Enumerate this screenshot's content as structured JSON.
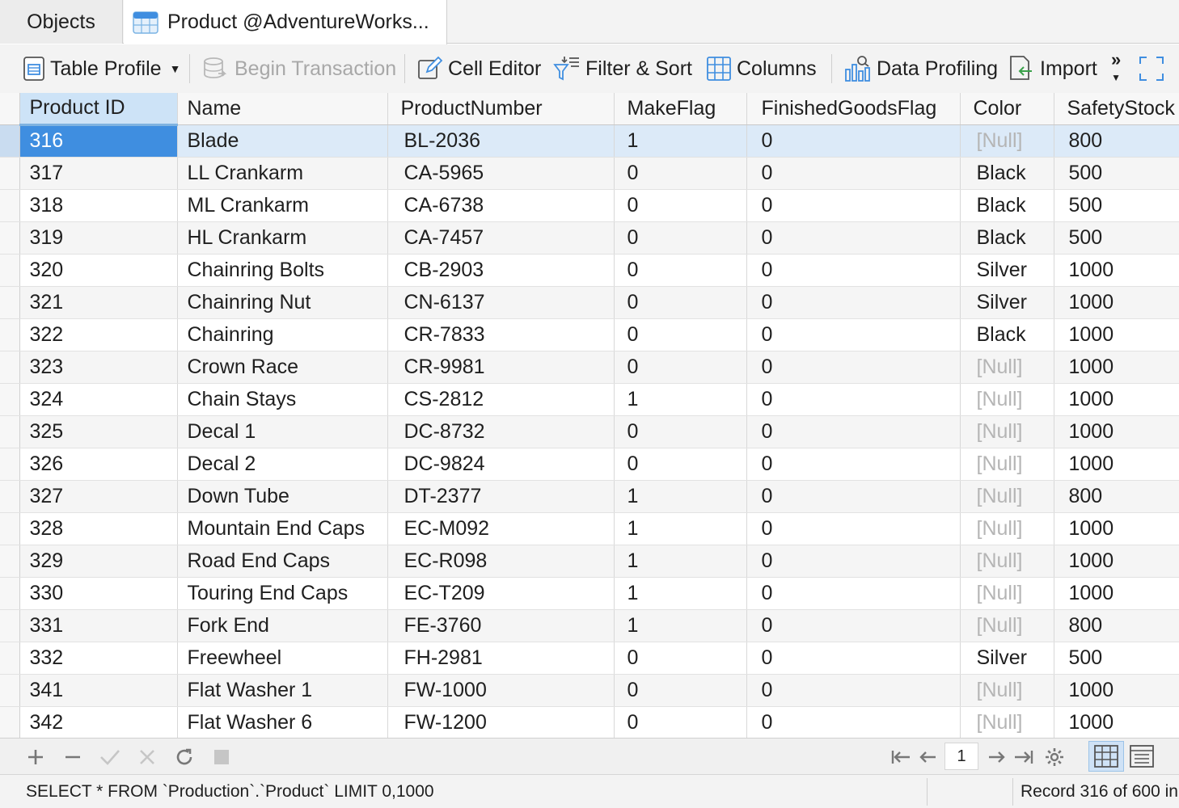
{
  "tabs": [
    {
      "label": "Objects"
    },
    {
      "label": "Product @AdventureWorks..."
    }
  ],
  "toolbar": {
    "table_profile": "Table Profile",
    "begin_transaction": "Begin Transaction",
    "cell_editor": "Cell Editor",
    "filter_sort": "Filter & Sort",
    "columns": "Columns",
    "data_profiling": "Data Profiling",
    "import": "Import",
    "more": "»"
  },
  "grid": {
    "columns": [
      "Product ID",
      "Name",
      "ProductNumber",
      "MakeFlag",
      "FinishedGoodsFlag",
      "Color",
      "SafetyStock"
    ],
    "rows": [
      [
        "316",
        "Blade",
        "BL-2036",
        "1",
        "0",
        "[Null]",
        "800"
      ],
      [
        "317",
        "LL Crankarm",
        "CA-5965",
        "0",
        "0",
        "Black",
        "500"
      ],
      [
        "318",
        "ML Crankarm",
        "CA-6738",
        "0",
        "0",
        "Black",
        "500"
      ],
      [
        "319",
        "HL Crankarm",
        "CA-7457",
        "0",
        "0",
        "Black",
        "500"
      ],
      [
        "320",
        "Chainring Bolts",
        "CB-2903",
        "0",
        "0",
        "Silver",
        "1000"
      ],
      [
        "321",
        "Chainring Nut",
        "CN-6137",
        "0",
        "0",
        "Silver",
        "1000"
      ],
      [
        "322",
        "Chainring",
        "CR-7833",
        "0",
        "0",
        "Black",
        "1000"
      ],
      [
        "323",
        "Crown Race",
        "CR-9981",
        "0",
        "0",
        "[Null]",
        "1000"
      ],
      [
        "324",
        "Chain Stays",
        "CS-2812",
        "1",
        "0",
        "[Null]",
        "1000"
      ],
      [
        "325",
        "Decal 1",
        "DC-8732",
        "0",
        "0",
        "[Null]",
        "1000"
      ],
      [
        "326",
        "Decal 2",
        "DC-9824",
        "0",
        "0",
        "[Null]",
        "1000"
      ],
      [
        "327",
        "Down Tube",
        "DT-2377",
        "1",
        "0",
        "[Null]",
        "800"
      ],
      [
        "328",
        "Mountain End Caps",
        "EC-M092",
        "1",
        "0",
        "[Null]",
        "1000"
      ],
      [
        "329",
        "Road End Caps",
        "EC-R098",
        "1",
        "0",
        "[Null]",
        "1000"
      ],
      [
        "330",
        "Touring End Caps",
        "EC-T209",
        "1",
        "0",
        "[Null]",
        "1000"
      ],
      [
        "331",
        "Fork End",
        "FE-3760",
        "1",
        "0",
        "[Null]",
        "800"
      ],
      [
        "332",
        "Freewheel",
        "FH-2981",
        "0",
        "0",
        "Silver",
        "500"
      ],
      [
        "341",
        "Flat Washer 1",
        "FW-1000",
        "0",
        "0",
        "[Null]",
        "1000"
      ],
      [
        "342",
        "Flat Washer 6",
        "FW-1200",
        "0",
        "0",
        "[Null]",
        "1000"
      ]
    ]
  },
  "pager": {
    "page": "1"
  },
  "status": {
    "sql": "SELECT * FROM `Production`.`Product` LIMIT 0,1000",
    "record": "Record 316 of 600 in"
  },
  "colors": {
    "accent": "#3f8ee0",
    "selection_row": "#dceaf8",
    "null_text": "#b5b5b5"
  }
}
